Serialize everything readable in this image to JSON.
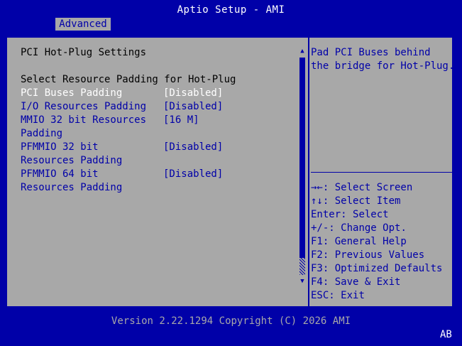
{
  "app": {
    "title": "Aptio Setup - AMI"
  },
  "tabs": [
    {
      "label": "Advanced"
    }
  ],
  "page": {
    "heading": "PCI Hot-Plug Settings",
    "section_label": "Select Resource Padding for Hot-Plug"
  },
  "settings": [
    {
      "label_lines": [
        "PCI Buses Padding"
      ],
      "value": "[Disabled]",
      "selected": true
    },
    {
      "label_lines": [
        "I/O Resources Padding"
      ],
      "value": "[Disabled]",
      "selected": false
    },
    {
      "label_lines": [
        "MMIO 32 bit Resources",
        "Padding"
      ],
      "value": "[16 M]",
      "selected": false
    },
    {
      "label_lines": [
        "PFMMIO 32 bit",
        "Resources Padding"
      ],
      "value": "[Disabled]",
      "selected": false
    },
    {
      "label_lines": [
        "PFMMIO 64 bit",
        "Resources Padding"
      ],
      "value": "[Disabled]",
      "selected": false
    }
  ],
  "help": {
    "lines": [
      "Pad PCI Buses behind",
      "the bridge for Hot-Plug."
    ]
  },
  "keys": [
    {
      "key": "→←",
      "action": ": Select Screen"
    },
    {
      "key": "↑↓",
      "action": ": Select Item"
    },
    {
      "key": "Enter",
      "action": ": Select"
    },
    {
      "key": "+/-",
      "action": ": Change Opt."
    },
    {
      "key": "F1",
      "action": ": General Help"
    },
    {
      "key": "F2",
      "action": ": Previous Values"
    },
    {
      "key": "F3",
      "action": ": Optimized Defaults"
    },
    {
      "key": "F4",
      "action": ": Save & Exit"
    },
    {
      "key": "ESC",
      "action": ": Exit"
    }
  ],
  "icons": {
    "scroll_up": "▲",
    "scroll_down": "▼"
  },
  "footer": {
    "version": "Version 2.22.1294 Copyright (C) 2026 AMI",
    "badge": "AB"
  }
}
